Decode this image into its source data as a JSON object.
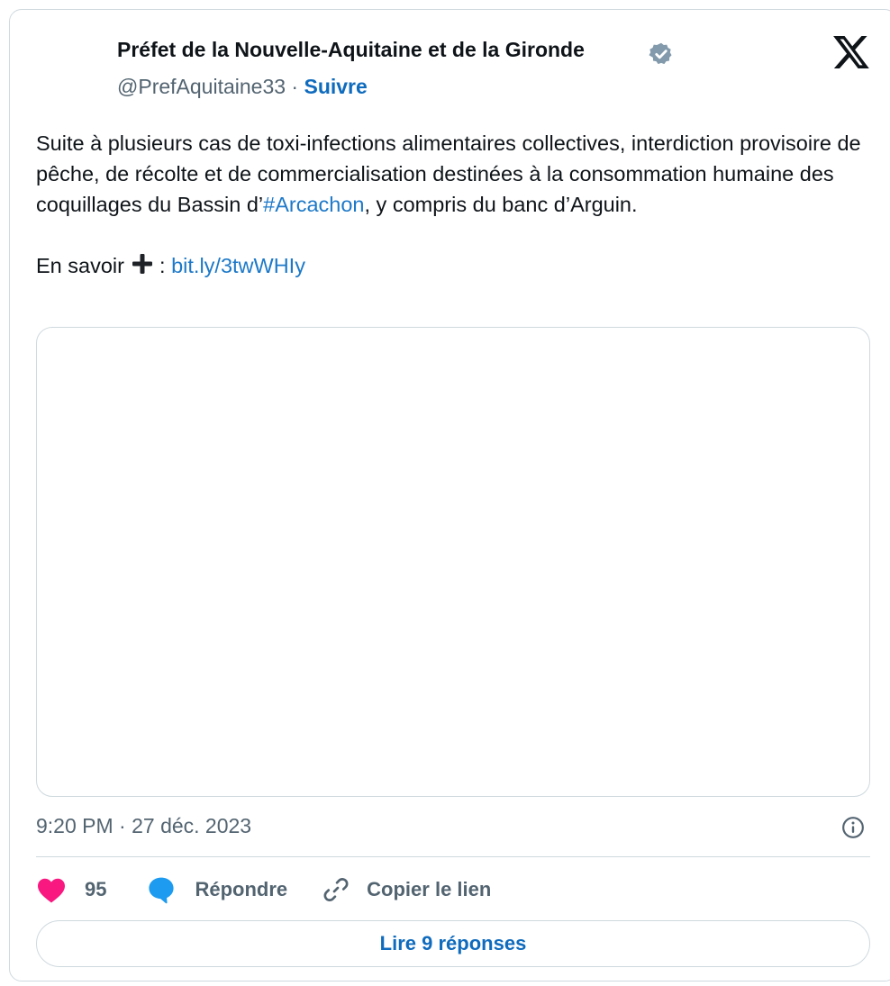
{
  "author": {
    "name": "Préfet de la Nouvelle-Aquitaine et de la Gironde",
    "handle": "@PrefAquitaine33",
    "separator": "·",
    "follow_label": "Suivre"
  },
  "tweet": {
    "paragraph1_before_hashtag": "Suite à plusieurs cas de toxi-infections alimentaires collectives, interdiction provisoire de pêche, de récolte et de commercialisation destinées à la consommation humaine des coquillages du Bassin d’",
    "hashtag": "#Arcachon",
    "paragraph1_after_hashtag": ", y compris du banc d’Arguin.",
    "paragraph2_prefix": "En savoir ",
    "paragraph2_colon": " : ",
    "link": "bit.ly/3twWHIy"
  },
  "timestamp": "9:20 PM · 27 déc. 2023",
  "actions": {
    "like_count": "95",
    "reply_label": "Répondre",
    "copy_label": "Copier le lien"
  },
  "read_replies_label": "Lire 9 réponses",
  "icons": {
    "verified": "verified-badge-icon",
    "brand": "x-logo-icon",
    "plus": "heavy-plus-icon",
    "info": "info-icon",
    "like": "heart-icon",
    "reply": "speech-bubble-icon",
    "copy": "link-icon"
  },
  "colors": {
    "accent": "#0f6bbd",
    "link": "#1d79c8",
    "heart": "#f91880",
    "reply": "#1d9bf0",
    "verified": "#829aab",
    "muted_text": "#536471",
    "border": "#cfd9de"
  }
}
